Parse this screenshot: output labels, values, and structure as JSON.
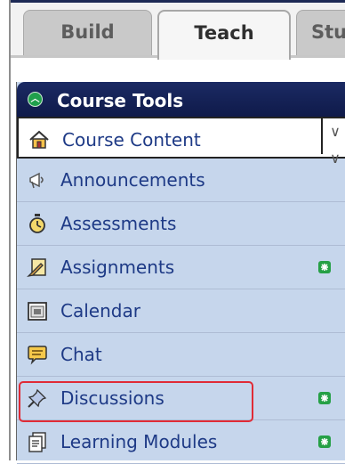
{
  "tabs": {
    "build": "Build",
    "teach": "Teach",
    "student": "Stu"
  },
  "course_tools": {
    "title": "Course Tools",
    "colors": {
      "header": "#1b2a63",
      "panel": "#c6d6ec",
      "link": "#1e3a86",
      "highlight": "#e02b36"
    },
    "items": [
      {
        "label": "Course Content",
        "icon": "home-icon",
        "active": true
      },
      {
        "label": "Announcements",
        "icon": "megaphone-icon"
      },
      {
        "label": "Assessments",
        "icon": "stopwatch-icon"
      },
      {
        "label": "Assignments",
        "icon": "pencil-paper-icon",
        "new": true
      },
      {
        "label": "Calendar",
        "icon": "calendar-icon"
      },
      {
        "label": "Chat",
        "icon": "speech-bubble-icon"
      },
      {
        "label": "Discussions",
        "icon": "pushpin-icon",
        "new": true,
        "highlighted": true
      },
      {
        "label": "Learning Modules",
        "icon": "document-stack-icon",
        "new": true
      }
    ]
  }
}
